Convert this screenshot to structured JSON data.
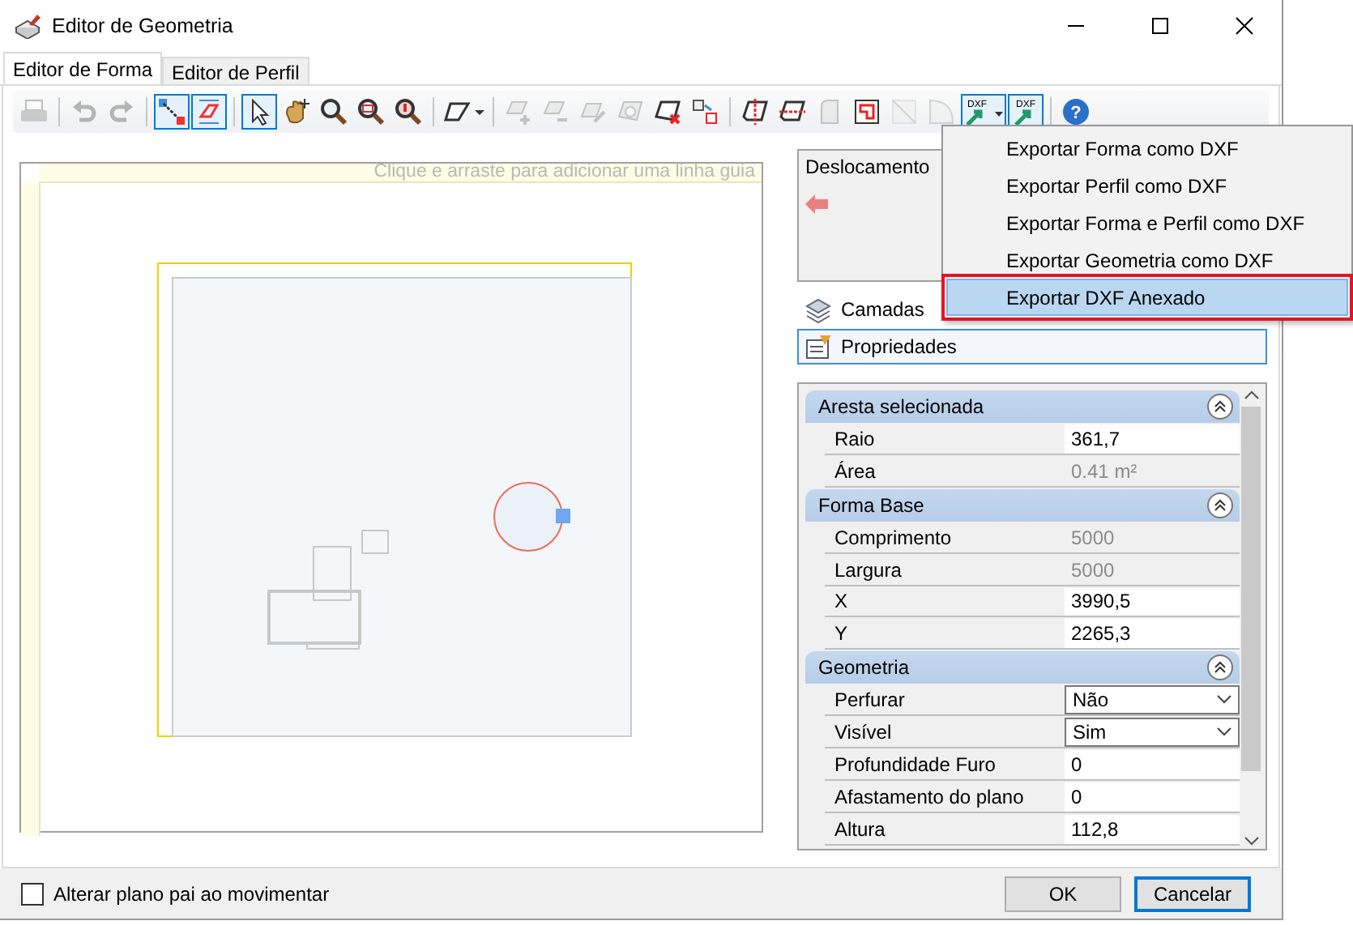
{
  "window": {
    "title": "Editor de Geometria"
  },
  "tabs": [
    {
      "label": "Editor de Forma",
      "selected": true
    },
    {
      "label": "Editor de Perfil",
      "selected": false
    }
  ],
  "toolbar": [
    {
      "kind": "print",
      "pressed": false,
      "disabled": true
    },
    {
      "kind": "separator"
    },
    {
      "kind": "undo",
      "pressed": false,
      "disabled": true
    },
    {
      "kind": "redo",
      "pressed": false,
      "disabled": true
    },
    {
      "kind": "separator"
    },
    {
      "kind": "snap-line",
      "pressed": true,
      "disabled": false
    },
    {
      "kind": "snap-shape",
      "pressed": true,
      "disabled": false
    },
    {
      "kind": "separator"
    },
    {
      "kind": "pointer",
      "pressed": true,
      "disabled": false
    },
    {
      "kind": "pan",
      "pressed": false,
      "disabled": false
    },
    {
      "kind": "zoom",
      "pressed": false,
      "disabled": false
    },
    {
      "kind": "zoom-window",
      "pressed": false,
      "disabled": false
    },
    {
      "kind": "zoom-extent",
      "pressed": false,
      "disabled": false
    },
    {
      "kind": "separator"
    },
    {
      "kind": "shape-menu",
      "pressed": false,
      "disabled": false
    },
    {
      "kind": "separator"
    },
    {
      "kind": "vertex-add",
      "pressed": false,
      "disabled": true
    },
    {
      "kind": "vertex-remove",
      "pressed": false,
      "disabled": true
    },
    {
      "kind": "shape-edit",
      "pressed": false,
      "disabled": true
    },
    {
      "kind": "hole",
      "pressed": false,
      "disabled": true
    },
    {
      "kind": "shape-delete",
      "pressed": false,
      "disabled": false
    },
    {
      "kind": "shape-move",
      "pressed": false,
      "disabled": false
    },
    {
      "kind": "separator"
    },
    {
      "kind": "cut-vertical",
      "pressed": false,
      "disabled": false
    },
    {
      "kind": "cut-horizontal",
      "pressed": false,
      "disabled": false
    },
    {
      "kind": "corner",
      "pressed": false,
      "disabled": true
    },
    {
      "kind": "frame",
      "pressed": false,
      "disabled": false
    },
    {
      "kind": "diagonal",
      "pressed": false,
      "disabled": true
    },
    {
      "kind": "arc",
      "pressed": false,
      "disabled": true
    },
    {
      "kind": "dxf-menu",
      "label": "DXF",
      "pressed": true,
      "disabled": false
    },
    {
      "kind": "dxf",
      "label": "DXF",
      "pressed": true,
      "disabled": false
    },
    {
      "kind": "separator"
    },
    {
      "kind": "help",
      "label": "?",
      "pressed": false,
      "disabled": false
    }
  ],
  "canvas": {
    "guide_placeholder": "Clique e arraste para adicionar uma linha guia"
  },
  "offset_panel": {
    "title": "Deslocamento"
  },
  "panels": [
    {
      "label": "Camadas",
      "selected": false
    },
    {
      "label": "Propriedades",
      "selected": true
    }
  ],
  "properties": [
    {
      "title": "Aresta selecionada",
      "expanded": true,
      "rows": [
        {
          "name": "Raio",
          "value": "361,7",
          "kind": "text"
        },
        {
          "name": "Área",
          "value": "0.41 m²",
          "kind": "readonly"
        }
      ]
    },
    {
      "title": "Forma Base",
      "expanded": true,
      "rows": [
        {
          "name": "Comprimento",
          "value": "5000",
          "kind": "readonly"
        },
        {
          "name": "Largura",
          "value": "5000",
          "kind": "readonly"
        },
        {
          "name": "X",
          "value": "3990,5",
          "kind": "text"
        },
        {
          "name": "Y",
          "value": "2265,3",
          "kind": "text"
        }
      ]
    },
    {
      "title": "Geometria",
      "expanded": true,
      "rows": [
        {
          "name": "Perfurar",
          "value": "Não",
          "kind": "dropdown"
        },
        {
          "name": "Visível",
          "value": "Sim",
          "kind": "dropdown"
        },
        {
          "name": "Profundidade Furo",
          "value": "0",
          "kind": "text"
        },
        {
          "name": "Afastamento do plano",
          "value": "0",
          "kind": "text"
        },
        {
          "name": "Altura",
          "value": "112,8",
          "kind": "text"
        }
      ]
    }
  ],
  "dxf_menu": [
    {
      "label": "Exportar Forma como DXF",
      "selected": false,
      "callout": false
    },
    {
      "label": "Exportar Perfil como DXF",
      "selected": false,
      "callout": false
    },
    {
      "label": "Exportar Forma e Perfil como DXF",
      "selected": false,
      "callout": false
    },
    {
      "label": "Exportar Geometria como DXF",
      "selected": false,
      "callout": false
    },
    {
      "label": "Exportar DXF Anexado",
      "selected": true,
      "callout": true
    }
  ],
  "footer": {
    "checkbox": {
      "label": "Alterar plano pai ao movimentar",
      "checked": false
    },
    "buttons": [
      {
        "label": "OK",
        "default": false
      },
      {
        "label": "Cancelar",
        "default": true
      }
    ]
  }
}
